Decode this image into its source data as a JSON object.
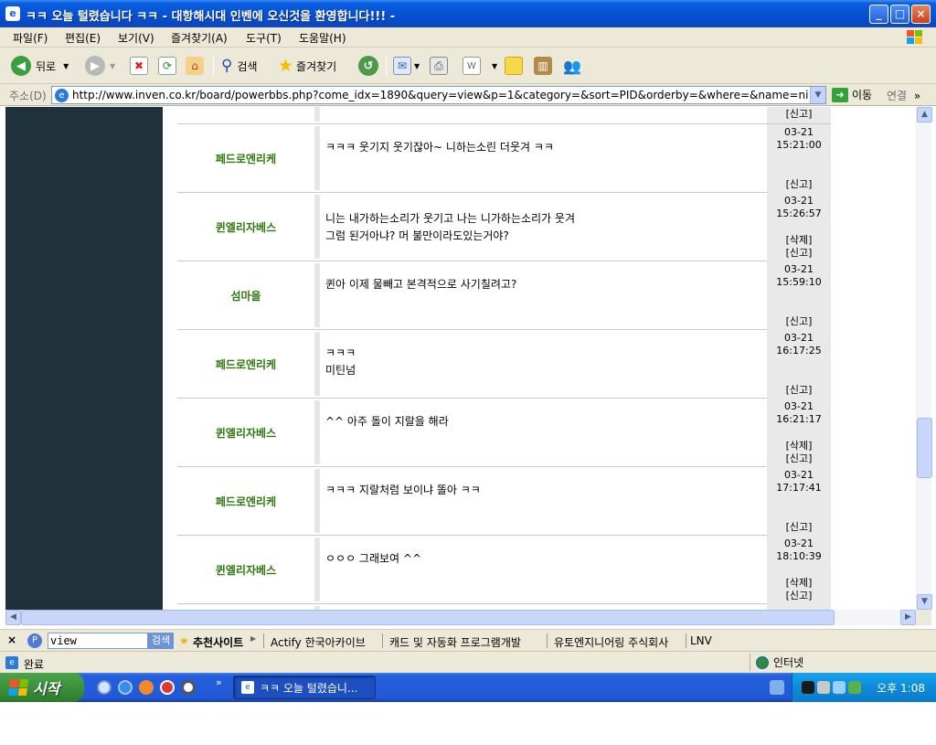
{
  "window": {
    "title": "ㅋㅋ 오늘 털렸습니다 ㅋㅋ - 대항해시대 인벤에 오신것을 환영합니다!!! -",
    "minimize": "_",
    "maximize": "□",
    "close": "×"
  },
  "menu": [
    "파일(F)",
    "편집(E)",
    "보기(V)",
    "즐겨찾기(A)",
    "도구(T)",
    "도움말(H)"
  ],
  "toolbar": {
    "back": "뒤로",
    "search": "검색",
    "favorites": "즐겨찾기"
  },
  "address": {
    "label": "주소(D)",
    "url": "http://www.inven.co.kr/board/powerbbs.php?come_idx=1890&query=view&p=1&category=&sort=PID&orderby=&where=&name=nicname&subject",
    "go": "이동",
    "links": "연결",
    "more": "»"
  },
  "top_partial": {
    "report": "[신고]"
  },
  "comments": [
    {
      "author": "페드로엔리케",
      "text": "ㅋㅋㅋ  웃기지 웃기잖아~ 니하는소린 더웃겨 ㅋㅋ",
      "date": "03-21",
      "time": "15:21:00",
      "delete": "",
      "report": "[신고]"
    },
    {
      "author": "퀸엘리자베스",
      "text": "니는 내가하는소리가 웃기고 나는 니가하는소리가 웃겨\n그럼 된거아냐? 머 불만이라도있는거야?",
      "date": "03-21",
      "time": "15:26:57",
      "delete": "[삭제]",
      "report": "[신고]"
    },
    {
      "author": "섬마을",
      "text": "퀸아 이제 물빼고 본격적으로 사기칠려고?",
      "date": "03-21",
      "time": "15:59:10",
      "delete": "",
      "report": "[신고]"
    },
    {
      "author": "페드로엔리케",
      "text": "ㅋㅋㅋ\n 미틴넘",
      "date": "03-21",
      "time": "16:17:25",
      "delete": "",
      "report": "[신고]"
    },
    {
      "author": "퀸엘리자베스",
      "text": "^^ 아주 돌이 지랄을 해라",
      "date": "03-21",
      "time": "16:21:17",
      "delete": "[삭제]",
      "report": "[신고]"
    },
    {
      "author": "페드로엔리케",
      "text": "ㅋㅋㅋ  지랄처럼 보이냐 똘아 ㅋㅋ",
      "date": "03-21",
      "time": "17:17:41",
      "delete": "",
      "report": "[신고]"
    },
    {
      "author": "퀸엘리자베스",
      "text": "ㅇㅇㅇ 그래보여 ^^",
      "date": "03-21",
      "time": "18:10:39",
      "delete": "[삭제]",
      "report": "[신고]"
    }
  ],
  "searchbar": {
    "close": "×",
    "query": "view",
    "search_btn": "검색",
    "recommend": "추천사이트",
    "links": [
      "Actify 한국아카이브",
      "캐드 및 자동화 프로그램개발",
      "유토엔지니어링 주식회사",
      "LNV"
    ]
  },
  "status": {
    "text": "완료",
    "zone": "인터넷"
  },
  "taskbar": {
    "start": "시작",
    "task": "ㅋㅋ 오늘 털렸습니...",
    "clock": "오후 1:08",
    "chevron": "»"
  }
}
